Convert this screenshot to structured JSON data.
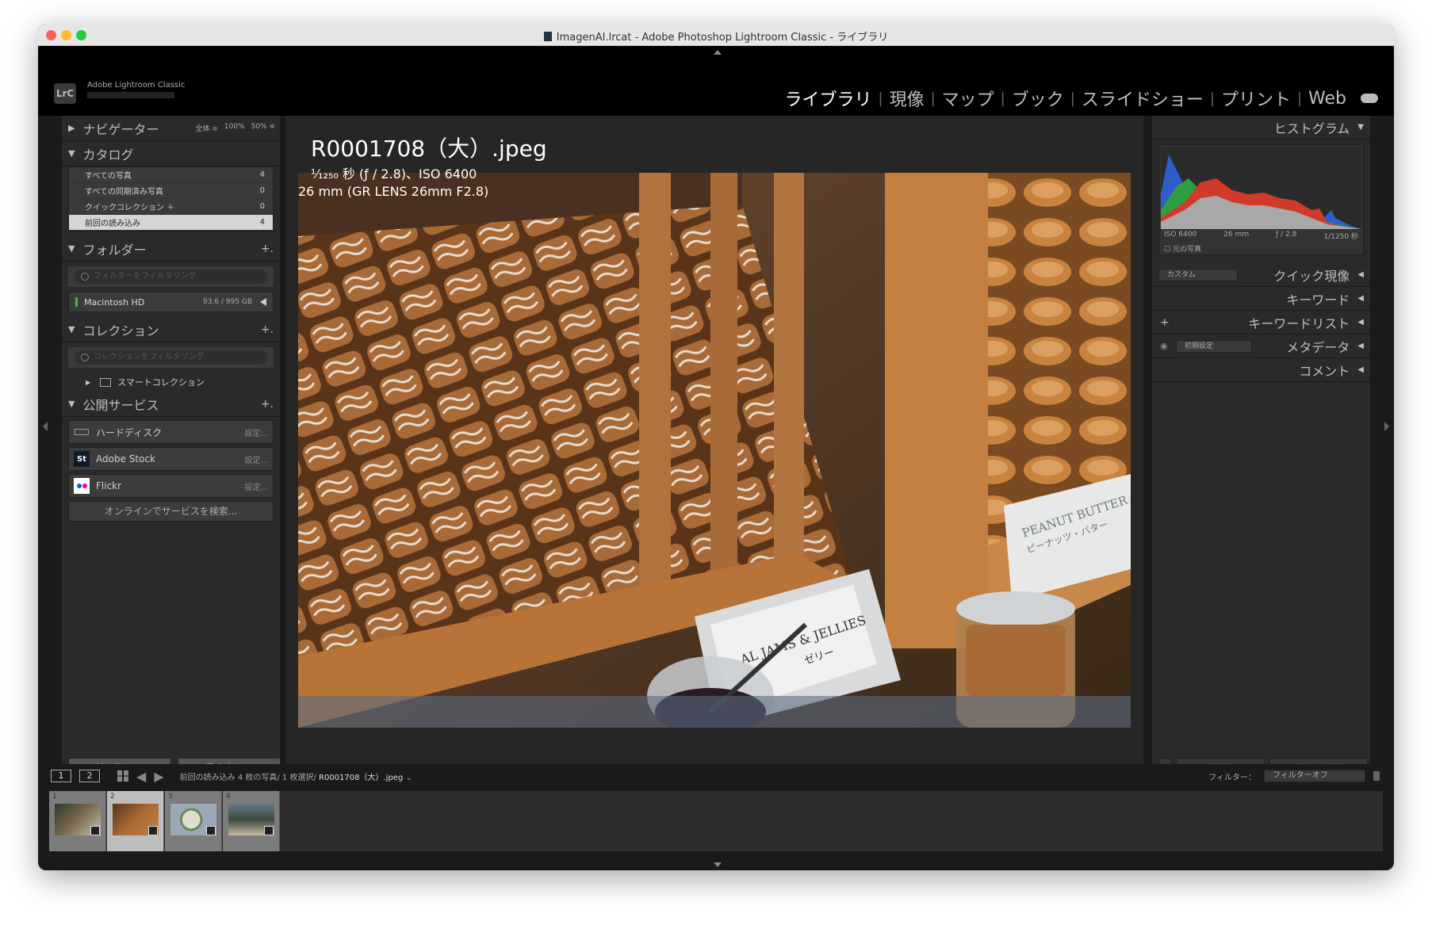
{
  "window": {
    "title": "ImagenAI.lrcat - Adobe Photoshop Lightroom Classic - ライブラリ"
  },
  "identity": {
    "logo": "LrC",
    "app_name": "Adobe Lightroom Classic",
    "modules": [
      "ライブラリ",
      "現像",
      "マップ",
      "ブック",
      "スライドショー",
      "プリント",
      "Web"
    ],
    "active_module": "ライブラリ"
  },
  "left": {
    "navigator": {
      "title": "ナビゲーター",
      "fit": "全体 ≑",
      "z1": "100%",
      "z2": "50% ≑"
    },
    "catalog": {
      "title": "カタログ",
      "items": [
        {
          "label": "すべての写真",
          "count": "4"
        },
        {
          "label": "すべての同期済み写真",
          "count": "0"
        },
        {
          "label": "クイックコレクション ＋",
          "count": "0"
        },
        {
          "label": "前回の読み込み",
          "count": "4"
        }
      ]
    },
    "folders": {
      "title": "フォルダー",
      "filter_placeholder": "フォルダーをフィルタリング",
      "volume": {
        "name": "Macintosh HD",
        "capacity": "93.6 / 995 GB"
      }
    },
    "collections": {
      "title": "コレクション",
      "filter_placeholder": "コレクションをフィルタリング",
      "smart": "スマートコレクション"
    },
    "publish": {
      "title": "公開サービス",
      "services": [
        {
          "label": "ハードディスク",
          "action": "設定..."
        },
        {
          "label": "Adobe Stock",
          "action": "設定...",
          "icon": "St"
        },
        {
          "label": "Flickr",
          "action": "設定..."
        }
      ],
      "find_more": "オンラインでサービスを検索..."
    },
    "import_btn": "読み込み...",
    "export_btn": "書き出し..."
  },
  "center": {
    "filename": "R0001708（大）.jpeg",
    "exposure": "¹⁄₁₂₅₀ 秒 (ƒ / 2.8)、ISO 6400",
    "lens": "26 mm (GR LENS 26mm F2.8)",
    "photo_text": {
      "sign": "PEANUT BUTTER",
      "sign_jp": "ピーナッツ・バター",
      "jams": "AL JAMS & JELLIES",
      "jams_jp": "ゼリー"
    }
  },
  "right": {
    "histogram": {
      "title": "ヒストグラム",
      "iso": "ISO 6400",
      "focal": "26 mm",
      "aperture": "ƒ / 2.8",
      "shutter": "1/1250 秒",
      "original": "元の写真"
    },
    "quick_develop": {
      "title": "クイック現像",
      "preset": "カスタム"
    },
    "keywords": "キーワード",
    "keyword_list": "キーワードリスト",
    "metadata": {
      "title": "メタデータ",
      "preset": "初期設定"
    },
    "comments": "コメント",
    "sync_btn": "同期",
    "sync_settings_btn": "設定を同期"
  },
  "filmbar": {
    "screens": [
      "1",
      "2"
    ],
    "source": "前回の読み込み",
    "summary": "4 枚の写真/ 1 枚選択/",
    "selected_file": "R0001708（大）.jpeg",
    "filter_label": "フィルター：",
    "filter_value": "フィルターオフ"
  },
  "filmstrip": {
    "thumbs": [
      {
        "num": "1",
        "selected": false
      },
      {
        "num": "2",
        "selected": true
      },
      {
        "num": "3",
        "selected": false
      },
      {
        "num": "4",
        "selected": false
      }
    ]
  },
  "colors": {
    "accent_close": "#ff5f57",
    "accent_min": "#febc2e",
    "accent_max": "#28c840"
  }
}
